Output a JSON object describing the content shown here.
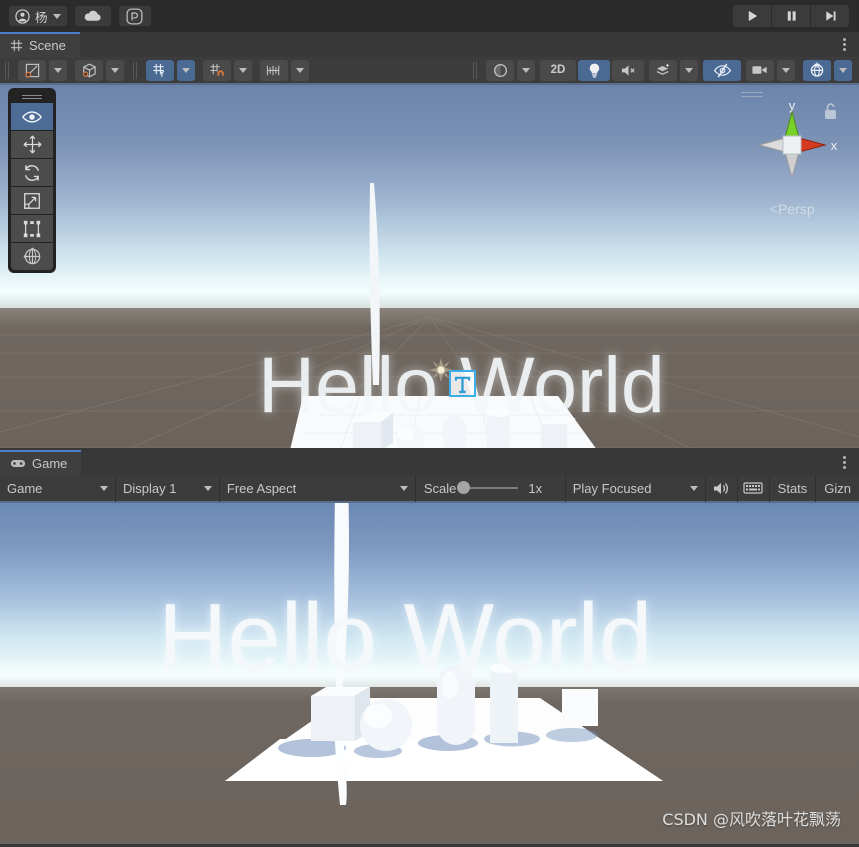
{
  "top_toolbar": {
    "account_button": {
      "label": "杨",
      "icon": "account-icon"
    },
    "cloud_button": {
      "icon": "cloud-icon"
    },
    "services_button": {
      "icon": "unity-services-icon"
    },
    "play_controls": [
      {
        "name": "play",
        "icon": "play-icon"
      },
      {
        "name": "pause",
        "icon": "pause-icon"
      },
      {
        "name": "step",
        "icon": "step-icon"
      }
    ]
  },
  "scene_panel": {
    "tab_label": "Scene",
    "tab_icon": "scene-grid-icon",
    "toolbar": {
      "draw_mode": {
        "label": "",
        "icon": "shaded-mode-icon"
      },
      "gizmo_toggle": {
        "icon": "2d-wireframe-cube-icon"
      },
      "grid_snap": {
        "icon": "grid-axis-y-icon",
        "active": true
      },
      "snap_increment": {
        "icon": "grid-magnet-icon",
        "active": false
      },
      "grid_size": {
        "icon": "ruler-icon"
      },
      "shading": {
        "icon": "sphere-shading-icon"
      },
      "view_2d": {
        "label": "2D",
        "active": false
      },
      "lighting": {
        "icon": "lightbulb-icon",
        "active": true
      },
      "audio": {
        "icon": "audio-muted-icon",
        "active": false
      },
      "fx": {
        "icon": "effects-layers-icon",
        "active": false
      },
      "hidden_objects": {
        "icon": "eye-slash-icon",
        "active": true
      },
      "camera": {
        "icon": "camera-icon",
        "active": false
      },
      "gizmos": {
        "icon": "gizmos-globe-icon",
        "active": true
      }
    },
    "tools_overlay": [
      {
        "name": "view-tool",
        "icon": "eye-icon",
        "active": true
      },
      {
        "name": "move-tool",
        "icon": "move-arrows-icon",
        "active": false
      },
      {
        "name": "rotate-tool",
        "icon": "rotate-icon",
        "active": false
      },
      {
        "name": "scale-tool",
        "icon": "scale-icon",
        "active": false
      },
      {
        "name": "rect-tool",
        "icon": "rect-transform-icon",
        "active": false
      },
      {
        "name": "transform-tool",
        "icon": "transform-icon",
        "active": false
      }
    ],
    "gizmo": {
      "axis_y_label": "y",
      "axis_x_label": "x",
      "perspective_label": "Persp",
      "lock_icon": "lock-open-icon",
      "axis_y_color": "#7ad12c",
      "axis_x_color": "#d63a21",
      "axis_z_color": "#cfcfcf"
    },
    "scene_text": "Hello World",
    "gizmo_icons": {
      "light": "light-gizmo-icon",
      "text_selected": "text-gizmo-icon"
    }
  },
  "game_panel": {
    "tab_label": "Game",
    "tab_icon": "gamepad-icon",
    "toolbar": {
      "game_selector": "Game",
      "display_selector": "Display 1",
      "aspect_selector": "Free Aspect",
      "scale_label": "Scale",
      "scale_value": "1x",
      "play_mode": "Play Focused",
      "mute_icon": "speaker-icon",
      "keyboard_icon": "keyboard-icon",
      "stats_label": "Stats",
      "gizmos_label": "Gizn"
    },
    "game_text": "Hello World",
    "watermark": "CSDN @风吹落叶花飘荡"
  },
  "colors": {
    "accent_blue": "#4b7fce",
    "toolbar_bg": "#3c3c3c",
    "panel_bg": "#383838",
    "button_active": "#4b6a93"
  }
}
